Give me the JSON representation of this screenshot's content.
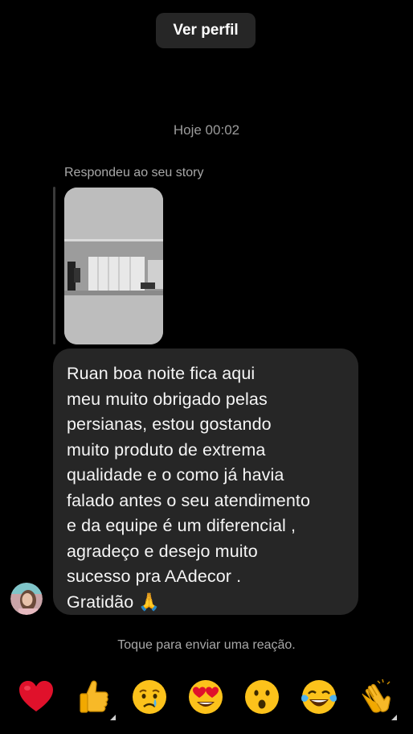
{
  "header": {
    "view_profile_label": "Ver perfil"
  },
  "conversation": {
    "timestamp": "Hoje 00:02",
    "story_reply_label": "Respondeu ao seu story",
    "message_text": "Ruan boa noite fica aqui\nmeu muito obrigado pelas\npersianas,  estou gostando\nmuito produto de extrema\nqualidade e o como já havia\nfalado antes o seu atendimento\ne da equipe é um diferencial ,\nagradeço e desejo muito\nsucesso pra AAdecor .\nGratidão 🙏"
  },
  "footer": {
    "reaction_hint": "Toque para enviar uma reação.",
    "reactions": [
      {
        "name": "red-heart",
        "glyph": "❤️"
      },
      {
        "name": "thumbs-up",
        "glyph": "👍"
      },
      {
        "name": "crying-face",
        "glyph": "😢"
      },
      {
        "name": "heart-eyes",
        "glyph": "😍"
      },
      {
        "name": "surprised-face",
        "glyph": "😮"
      },
      {
        "name": "tears-of-joy",
        "glyph": "😂"
      },
      {
        "name": "clapping-hands",
        "glyph": "👏"
      }
    ]
  },
  "colors": {
    "background": "#000000",
    "bubble": "#262626",
    "secondary_text": "#a8a8a8"
  }
}
